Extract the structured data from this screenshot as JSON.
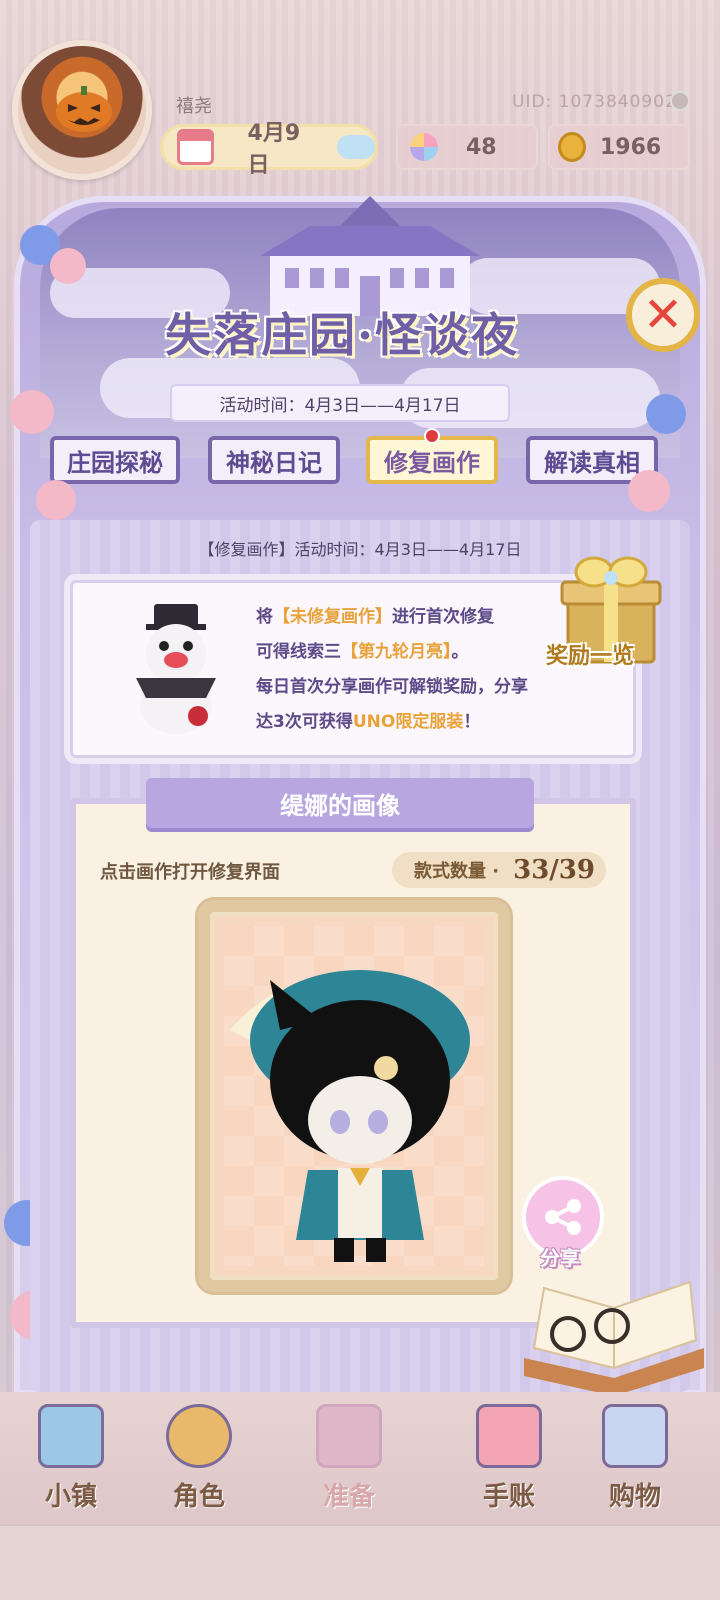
{
  "user": {
    "name": "禧尧",
    "uid": "UID: 1073840902"
  },
  "status": {
    "date": "4月9日",
    "flowers": "48",
    "coins": "1966"
  },
  "event": {
    "title": "失落庄园·怪谈夜",
    "time": "活动时间：4月3日——4月17日"
  },
  "tabs": [
    {
      "label": "庄园探秘"
    },
    {
      "label": "神秘日记"
    },
    {
      "label": "修复画作"
    },
    {
      "label": "解读真相"
    }
  ],
  "panel": {
    "time": "【修复画作】活动时间：4月3日——4月17日",
    "info": {
      "line1_pre": "将",
      "line1_hl": "【未修复画作】",
      "line1_post": "进行首次修复",
      "line2_pre": "可得线索三",
      "line2_hl": "【第九轮月亮】",
      "line2_post": "。",
      "line3": "每日首次分享画作可解锁奖励，分享",
      "line4_pre": "达3次可获得",
      "line4_hl": "UNO限定服装",
      "line4_post": "！"
    },
    "reward_label": "奖励一览"
  },
  "portrait": {
    "title": "缇娜的画像",
    "hint": "点击画作打开修复界面",
    "count_label": "款式数量 ·",
    "count_value": "33/39",
    "share_label": "分享"
  },
  "nav": [
    {
      "label": "小镇",
      "icon": "map-icon"
    },
    {
      "label": "角色",
      "icon": "character-icon"
    },
    {
      "label": "准备",
      "icon": "dressup-icon"
    },
    {
      "label": "手账",
      "icon": "journal-icon"
    },
    {
      "label": "购物",
      "icon": "shopping-bag-icon"
    }
  ],
  "colors": {
    "accent": "#7866aa",
    "highlight": "#e9a23a",
    "close_red": "#e6453b"
  }
}
